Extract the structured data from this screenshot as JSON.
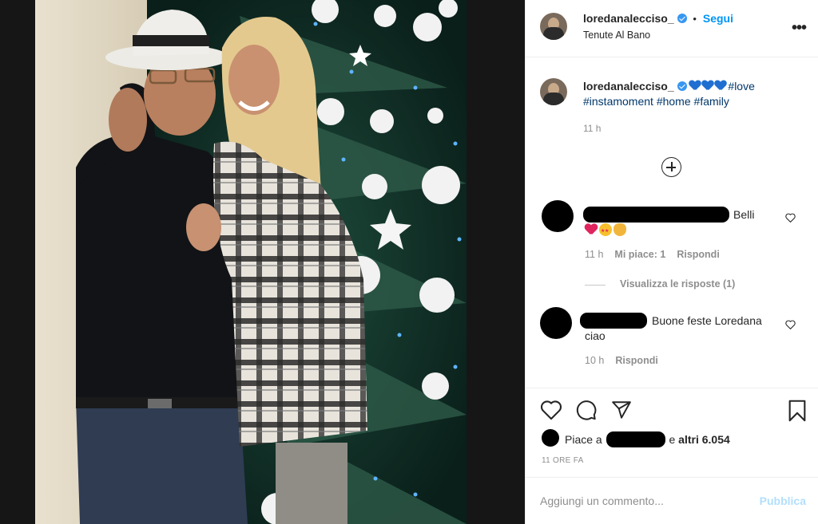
{
  "post": {
    "author": "loredanalecciso_",
    "follow_label": "Segui",
    "separator": "•",
    "location": "Tenute Al Bano",
    "more_label": "•••"
  },
  "caption": {
    "author": "loredanalecciso_",
    "hashtags": [
      "#love",
      "#instamoment",
      "#home",
      "#family"
    ],
    "time": "11 h"
  },
  "comments": [
    {
      "text": "Belli",
      "time": "11 h",
      "likes": "Mi piace: 1",
      "reply_label": "Rispondi",
      "view_replies": "Visualizza le risposte (1)"
    },
    {
      "text_line1": "Buone feste Loredana",
      "text_line2": "ciao",
      "time": "10 h",
      "reply_label": "Rispondi"
    }
  ],
  "likes": {
    "prefix": "Piace a",
    "mid": "e",
    "count": "altri 6.054"
  },
  "posted": "11 ORE FA",
  "composer": {
    "placeholder": "Aggiungi un commento...",
    "publish_label": "Pubblica"
  },
  "colors": {
    "accent": "#0095f6",
    "publish_disabled": "#b2dffc",
    "hashtag": "#00376b",
    "muted": "#8e8e8e"
  },
  "icons": [
    "heart-icon",
    "comment-icon",
    "share-icon",
    "bookmark-icon",
    "add-icon",
    "verified-icon",
    "more-options-icon"
  ]
}
